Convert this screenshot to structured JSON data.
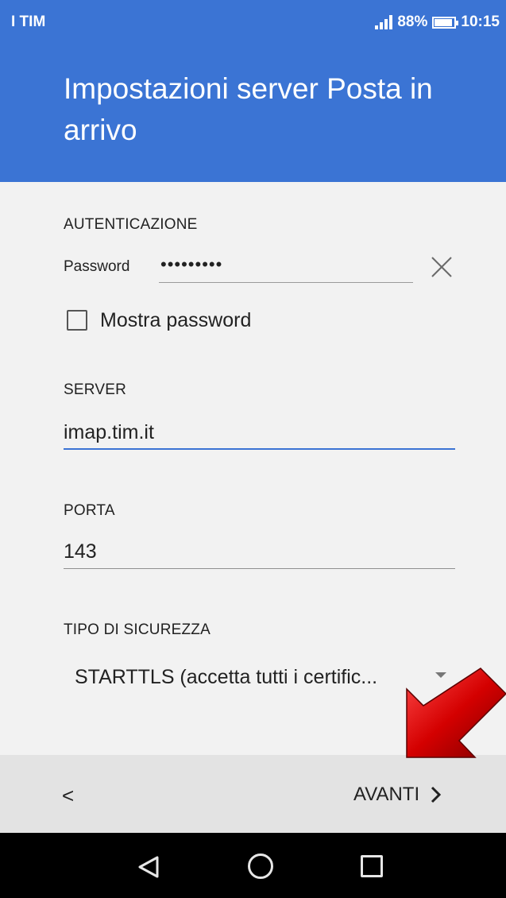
{
  "status_bar": {
    "carrier": "I TIM",
    "battery": "88%",
    "time": "10:15",
    "icons": [
      "signal-icon",
      "battery-icon"
    ]
  },
  "header": {
    "title": "Impostazioni server Posta in arrivo"
  },
  "auth": {
    "section": "AUTENTICAZIONE",
    "password_label": "Password",
    "password_value": "•••••••••",
    "clear_icon": "close-icon",
    "show_password_label": "Mostra password",
    "show_password_checked": false
  },
  "server": {
    "section": "SERVER",
    "value": "imap.tim.it"
  },
  "port": {
    "section": "PORTA",
    "value": "143"
  },
  "security": {
    "section": "TIPO DI SICUREZZA",
    "value": "STARTTLS (accetta tutti i certific..."
  },
  "footer": {
    "back_label": "<",
    "next_label": "AVANTI",
    "next_icon": "chevron-right-icon"
  },
  "nav_bar": {
    "icons": [
      "back-triangle-icon",
      "home-circle-icon",
      "recent-square-icon"
    ]
  },
  "colors": {
    "header_blue": "#3b74d4",
    "background": "#f2f2f2",
    "footer": "#e3e3e3",
    "annotation_arrow": "#d40000"
  }
}
